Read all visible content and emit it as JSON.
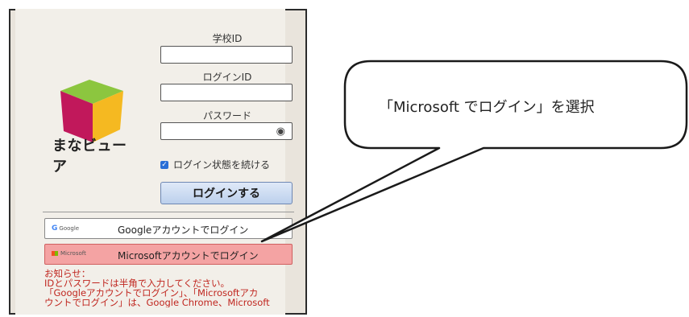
{
  "login_form": {
    "school_id_label": "学校ID",
    "login_id_label": "ログインID",
    "password_label": "パスワード",
    "keep_login_label": "ログイン状態を続ける",
    "login_button": "ログインする"
  },
  "brand": {
    "name": "まなビューア",
    "icon": "book-logo-icon"
  },
  "sso": {
    "google_brand": "Google",
    "google_label": "Googleアカウントでログイン",
    "microsoft_brand": "Microsoft",
    "microsoft_label": "Microsoftアカウントでログイン"
  },
  "notice": {
    "heading": "お知らせ：",
    "line1": "IDとパスワードは半角で入力してください。",
    "line2": "「Googleアカウントでログイン」、「Microsoftアカ",
    "line3": "ウントでログイン」は、Google Chrome、Microsoft"
  },
  "callout": {
    "text": "「Microsoft でログイン」を選択"
  },
  "colors": {
    "highlight": "#f4a3a3",
    "notice_text": "#c0261f",
    "button_blue": "#bcd0ec"
  }
}
